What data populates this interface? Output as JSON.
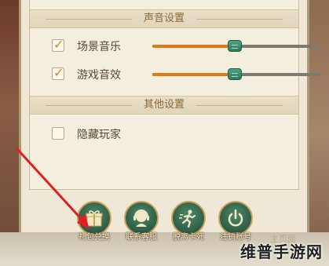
{
  "sound_settings": {
    "title": "声音设置",
    "rows": [
      {
        "label": "场景音乐",
        "checked": true,
        "level": 0.49
      },
      {
        "label": "游戏音效",
        "checked": true,
        "level": 0.49
      }
    ]
  },
  "other_settings": {
    "title": "其他设置",
    "rows": [
      {
        "label": "隐藏玩家",
        "checked": false
      }
    ]
  },
  "buttons": [
    {
      "label": "礼包兑换",
      "icon": "gift-icon"
    },
    {
      "label": "联系客服",
      "icon": "customer-service-icon"
    },
    {
      "label": "脱离卡死",
      "icon": "running-man-icon"
    },
    {
      "label": "注销账号",
      "icon": "power-icon"
    }
  ],
  "faint_text": "主页面",
  "watermark": "维普手游网",
  "colors": {
    "accent_orange": "#e07a18",
    "knob_green": "#3f8f72",
    "annotation_red": "#e02020"
  }
}
